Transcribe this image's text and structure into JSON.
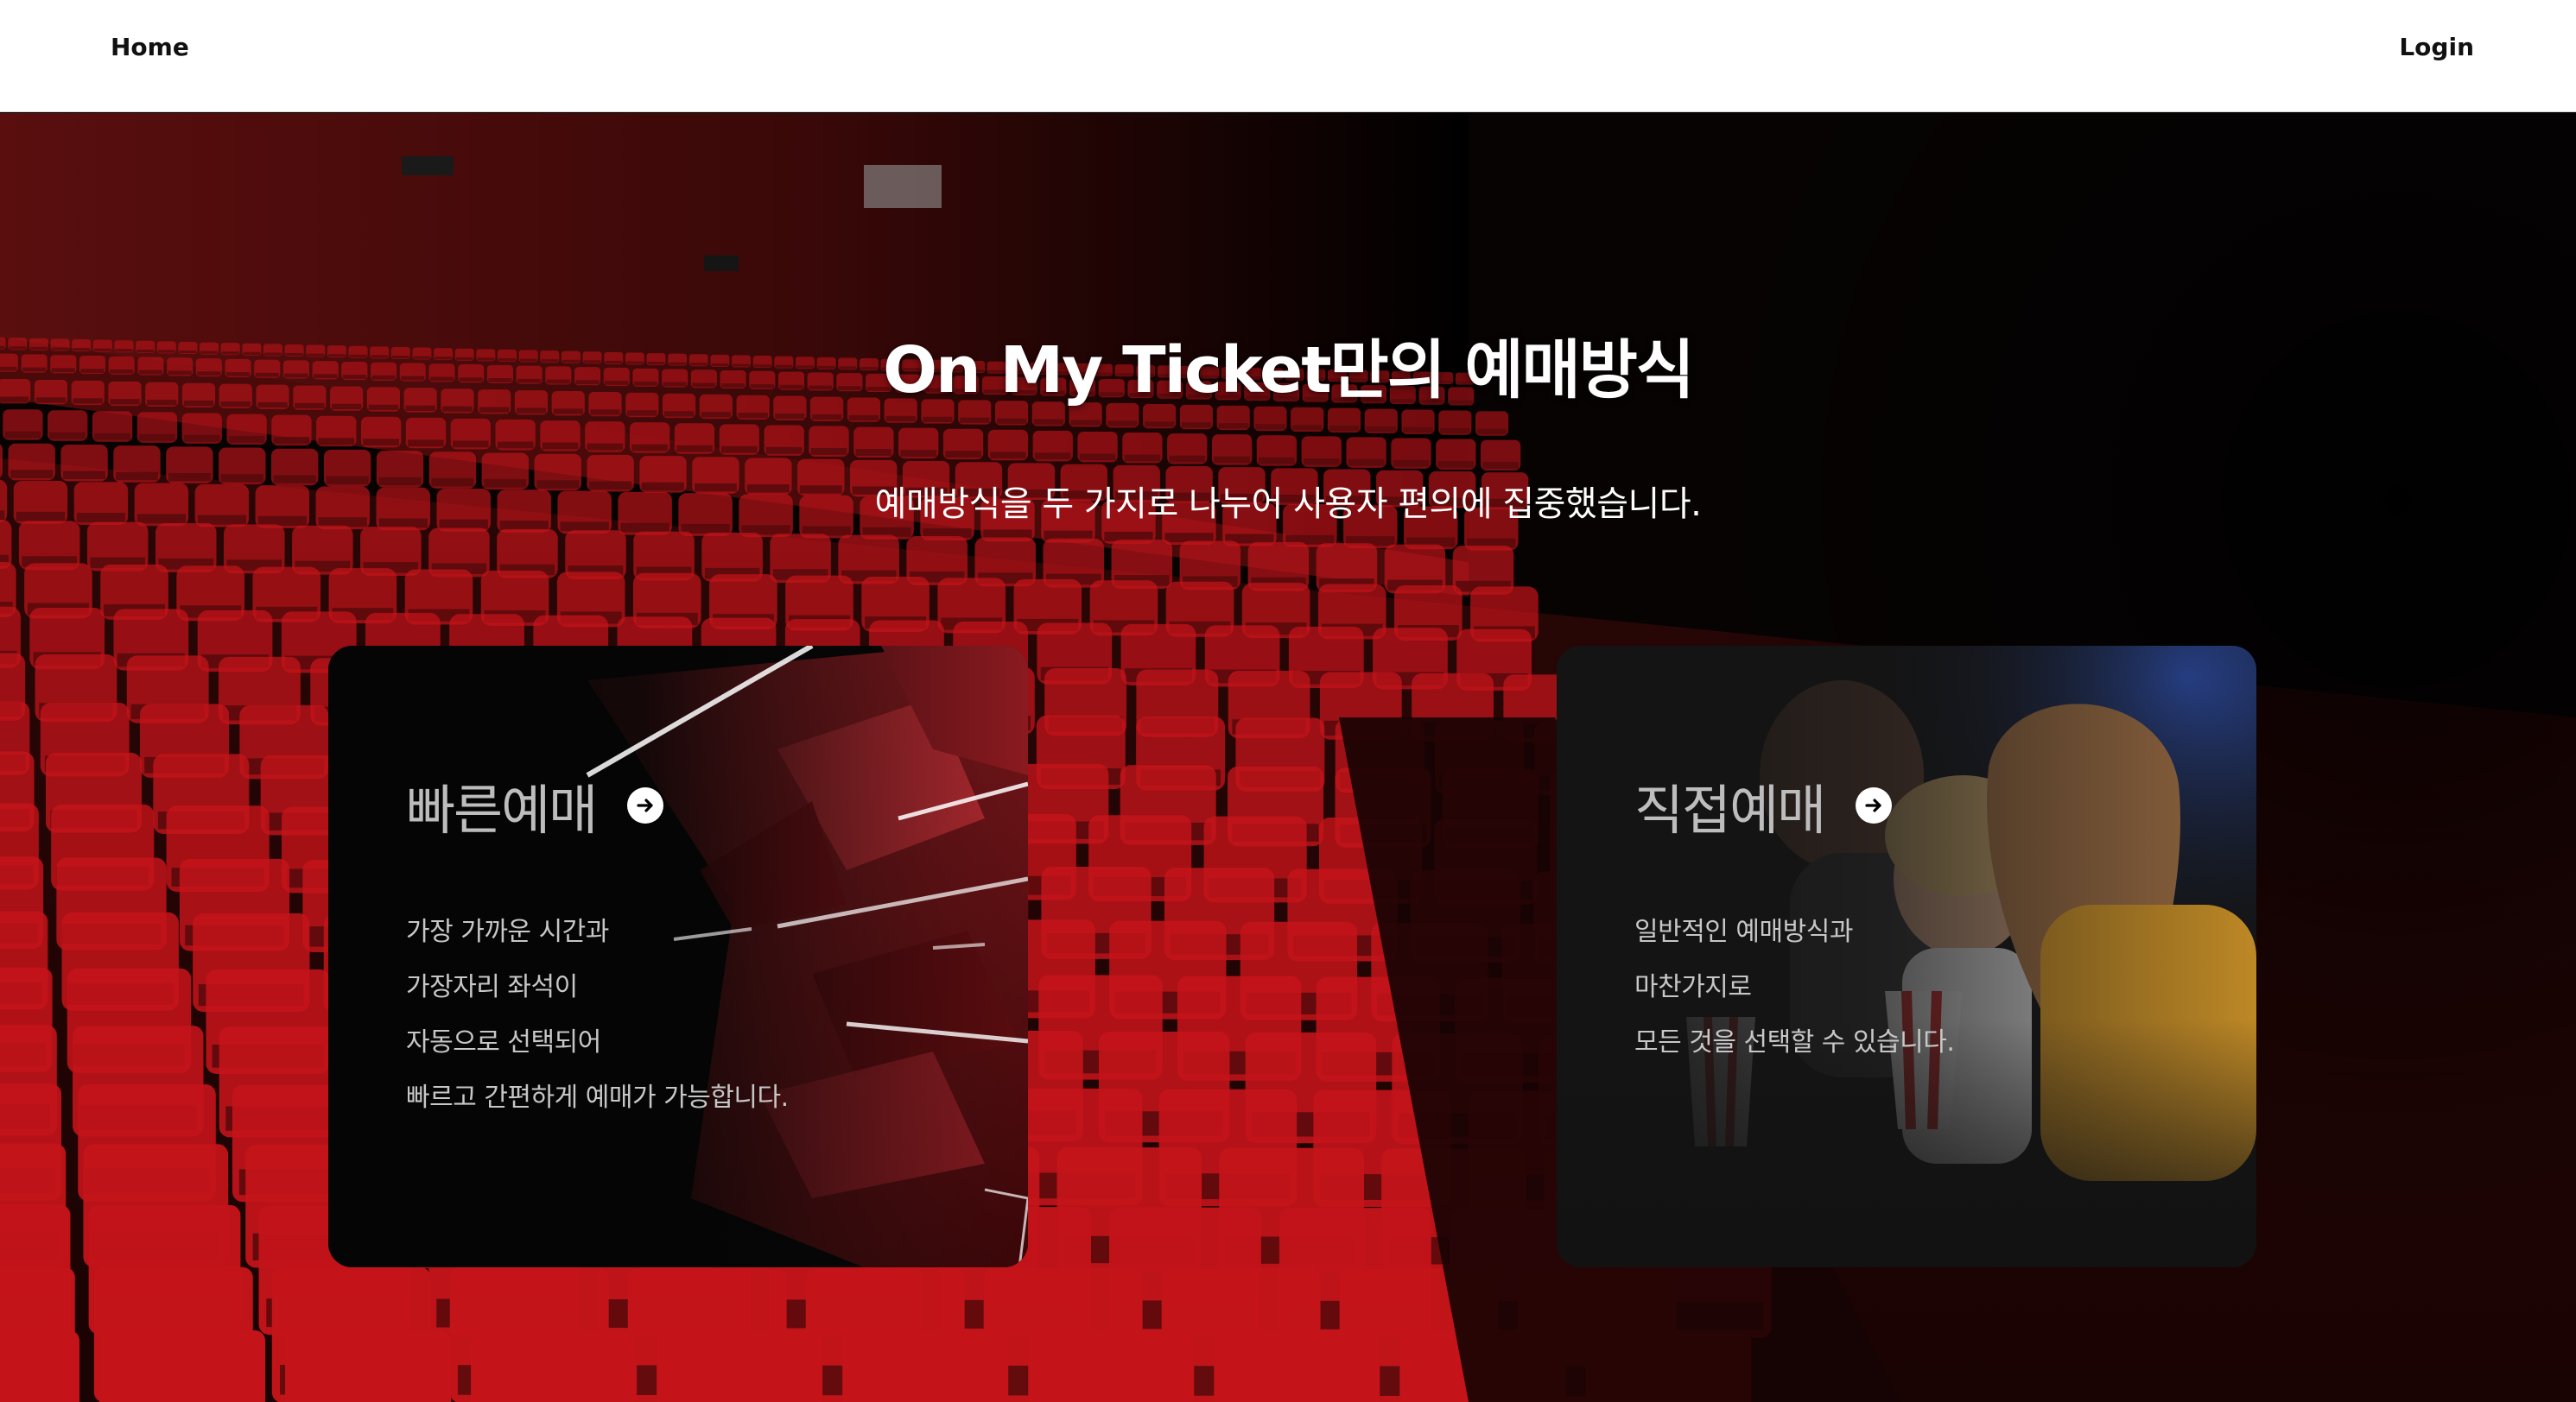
{
  "nav": {
    "home_label": "Home",
    "login_label": "Login"
  },
  "hero": {
    "title": "On My Ticket만의 예매방식",
    "subtitle": "예매방식을 두 가지로 나누어 사용자 편의에 집중했습니다."
  },
  "cards": [
    {
      "title": "빠른예매",
      "icon": "arrow-right-circle-icon",
      "lines": [
        "가장 가까운 시간과",
        "가장자리 좌석이",
        "자동으로 선택되어",
        "빠르고 간편하게 예매가 가능합니다."
      ]
    },
    {
      "title": "직접예매",
      "icon": "arrow-right-circle-icon",
      "lines": [
        "일반적인 예매방식과",
        "마찬가지로",
        "모든 것을 선택할 수 있습니다."
      ]
    }
  ],
  "colors": {
    "seat_red": "#c4141a",
    "navbar_bg": "#ffffff",
    "card_text": "#c7c7c7"
  }
}
